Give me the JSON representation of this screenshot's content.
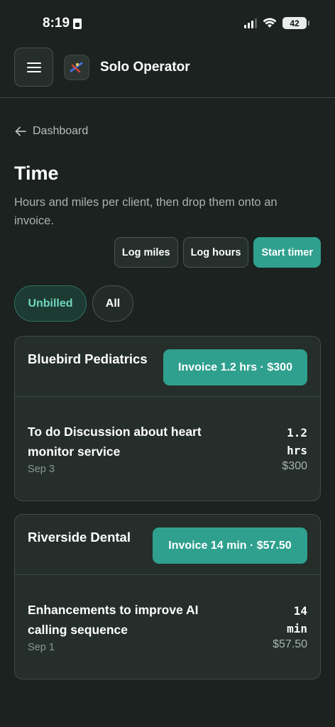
{
  "status_bar": {
    "time": "8:19",
    "battery": "42"
  },
  "header": {
    "menu_icon": "hamburger-menu-icon",
    "logo_icon": "solo-operator-logo",
    "app_title": "Solo Operator"
  },
  "breadcrumb": {
    "icon": "arrow-left-icon",
    "label": "Dashboard"
  },
  "page": {
    "title": "Time",
    "subtitle": "Hours and miles per client, then drop them onto an invoice."
  },
  "actions": {
    "log_miles": "Log miles",
    "log_hours": "Log hours",
    "start_timer": "Start timer"
  },
  "filters": [
    {
      "label": "Unbilled",
      "active": true
    },
    {
      "label": "All",
      "active": false
    }
  ],
  "colors": {
    "background": "#1b221f",
    "card": "#252e2a",
    "accent": "#2fa08e",
    "accent_text": "#6fd6bd"
  },
  "clients": [
    {
      "name": "Bluebird Pediatrics",
      "invoice_label": "Invoice 1.2 hrs · $300",
      "entries": [
        {
          "description": "To do Discussion about heart monitor service",
          "date": "Sep 3",
          "quantity_value": "1.2",
          "quantity_unit": "hrs",
          "amount": "$300"
        }
      ]
    },
    {
      "name": "Riverside Dental",
      "invoice_label": "Invoice 14 min · $57.50",
      "entries": [
        {
          "description": "Enhancements to improve AI calling sequence",
          "date": "Sep 1",
          "quantity_value": "14",
          "quantity_unit": "min",
          "amount": "$57.50"
        }
      ]
    }
  ]
}
